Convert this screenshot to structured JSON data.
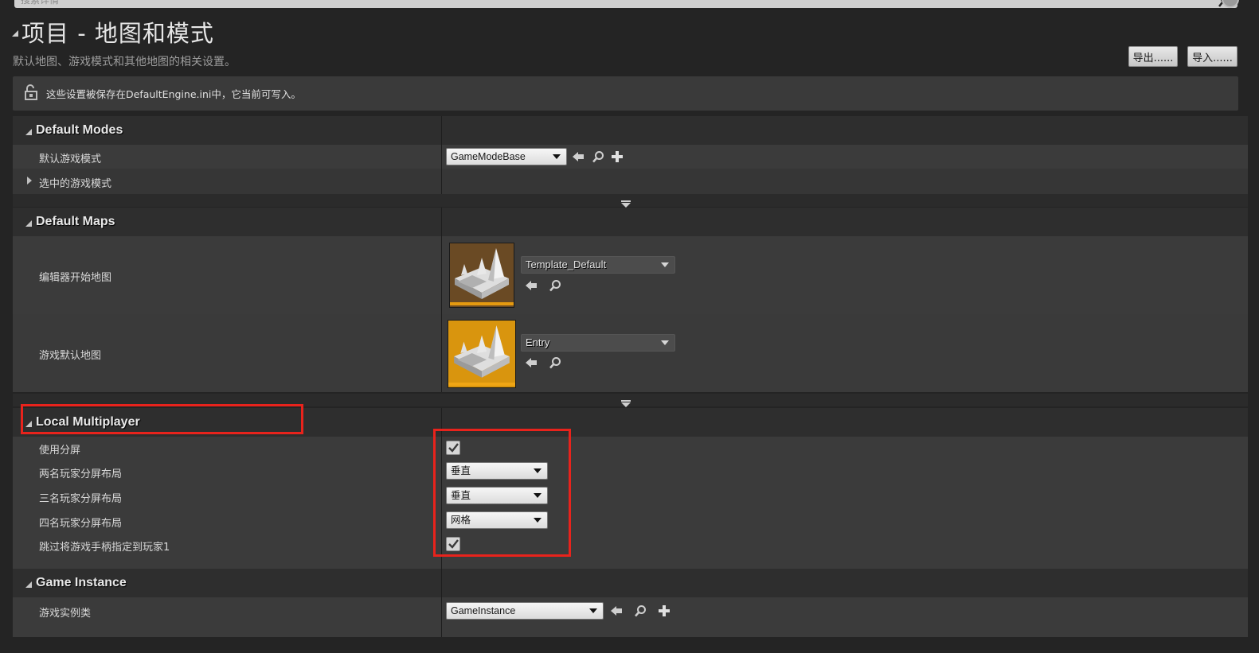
{
  "search": {
    "placeholder": "搜索详情"
  },
  "header": {
    "title": "项目 - 地图和模式",
    "subtitle": "默认地图、游戏模式和其他地图的相关设置。",
    "export_label": "导出......",
    "import_label": "导入......"
  },
  "notice": {
    "text": "这些设置被保存在DefaultEngine.ini中，它当前可写入。",
    "icon": "unlock-icon"
  },
  "sections": {
    "default_modes": {
      "title": "Default Modes",
      "default_game_mode": {
        "label": "默认游戏模式",
        "value": "GameModeBase"
      },
      "selected_game_mode": {
        "label": "选中的游戏模式"
      }
    },
    "default_maps": {
      "title": "Default Maps",
      "editor_startup_map": {
        "label": "编辑器开始地图",
        "value": "Template_Default"
      },
      "game_default_map": {
        "label": "游戏默认地图",
        "value": "Entry"
      }
    },
    "local_multiplayer": {
      "title": "Local Multiplayer",
      "use_splitscreen": {
        "label": "使用分屏",
        "checked": true
      },
      "two_player_layout": {
        "label": "两名玩家分屏布局",
        "value": "垂直"
      },
      "three_player_layout": {
        "label": "三名玩家分屏布局",
        "value": "垂直"
      },
      "four_player_layout": {
        "label": "四名玩家分屏布局",
        "value": "网格"
      },
      "skip_gamepad_assign": {
        "label": "跳过将游戏手柄指定到玩家1",
        "checked": true
      }
    },
    "game_instance": {
      "title": "Game Instance",
      "game_instance_class": {
        "label": "游戏实例类",
        "value": "GameInstance"
      }
    }
  },
  "colors": {
    "highlight": "#e8231c",
    "accent": "#e59a10"
  }
}
